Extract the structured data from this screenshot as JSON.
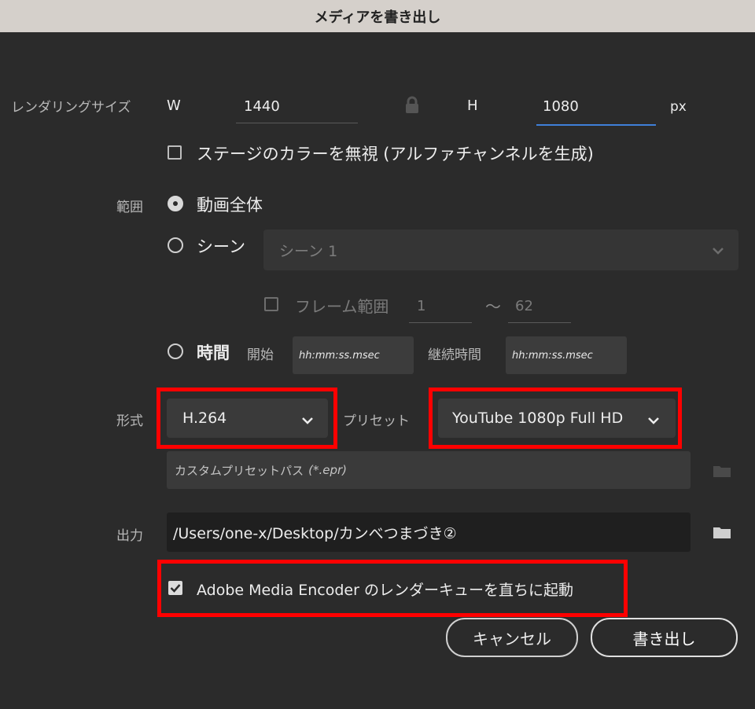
{
  "window": {
    "title": "メディアを書き出し"
  },
  "render_size": {
    "label": "レンダリングサイズ",
    "w_label": "W",
    "w_value": "1440",
    "h_label": "H",
    "h_value": "1080",
    "unit": "px",
    "ignore_stage_color_label": "ステージのカラーを無視 (アルファチャンネルを生成)",
    "ignore_stage_color_checked": false
  },
  "range": {
    "label": "範囲",
    "option_all": "動画全体",
    "option_scene": "シーン",
    "scene_select_value": "シーン 1",
    "frame_range_label": "フレーム範囲",
    "frame_from": "1",
    "frame_sep": "〜",
    "frame_to": "62",
    "option_time": "時間",
    "start_label": "開始",
    "start_placeholder": "hh:mm:ss.msec",
    "duration_label": "継続時間",
    "duration_placeholder": "hh:mm:ss.msec",
    "selected": "all"
  },
  "format": {
    "label": "形式",
    "value": "H.264",
    "preset_label": "プリセット",
    "preset_value": "YouTube 1080p Full HD",
    "custom_preset_placeholder": "カスタムプリセットパス",
    "custom_preset_ext": "(*.epr)"
  },
  "output": {
    "label": "出力",
    "path": "/Users/one-x/Desktop/カンべつまづき②"
  },
  "ame": {
    "label": "Adobe Media Encoder のレンダーキューを直ちに起動",
    "checked": true
  },
  "buttons": {
    "cancel": "キャンセル",
    "export": "書き出し"
  },
  "colors": {
    "background": "#2b2b2b",
    "title_bar": "#d5d0cb",
    "accent_blue": "#3f7fd9",
    "highlight_red": "#ff0000"
  }
}
